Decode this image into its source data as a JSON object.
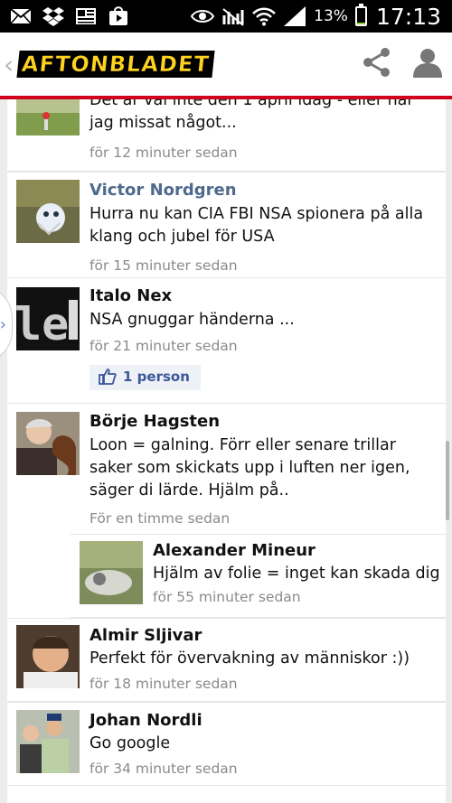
{
  "status_bar": {
    "battery_percent": "13%",
    "battery_level": 0.13,
    "battery_color": "#8bd33d",
    "time": "17:13",
    "left_icons": [
      "mail-icon",
      "dropbox-icon",
      "news-icon",
      "play-store-icon"
    ],
    "right_icons": [
      "eye-icon",
      "no-signal-icon",
      "wifi-icon",
      "signal-bars-icon"
    ]
  },
  "app_bar": {
    "logo_text": "AFTONBLADET",
    "logo_colors": {
      "fill": "#ffd21f",
      "outline": "#000000"
    },
    "accent_color": "#d0021b",
    "actions": [
      "share-icon",
      "profile-icon"
    ]
  },
  "comments": [
    {
      "name": "",
      "text": "Det är väl inte den 1 april idag - eller har jag missat något...",
      "time": "för 12 minuter sedan"
    },
    {
      "name": "Victor Nordgren",
      "text": "Hurra nu kan CIA FBI NSA spionera på alla klang och jubel för USA",
      "time": "för 15 minuter sedan"
    },
    {
      "name": "Italo Nex",
      "text": "NSA gnuggar händerna ...",
      "time": "för 21 minuter sedan",
      "likes": "1 person"
    },
    {
      "name": "Börje Hagsten",
      "text": "Loon = galning. Förr eller senare trillar saker som skickats upp i luften ner igen, säger di lärde. Hjälm på..",
      "time": "För en timme sedan"
    },
    {
      "name": "Alexander Mineur",
      "text": "Hjälm av folie = inget kan skada dig",
      "time": "för 55 minuter sedan"
    },
    {
      "name": "Almir Sljivar",
      "text": "Perfekt för övervakning av människor :))",
      "time": "för 18 minuter sedan"
    },
    {
      "name": "Johan Nordli",
      "text": "Go google",
      "time": "för 34 minuter sedan"
    }
  ],
  "link_color": "#4e6a8c",
  "like_color": "#3b5998"
}
